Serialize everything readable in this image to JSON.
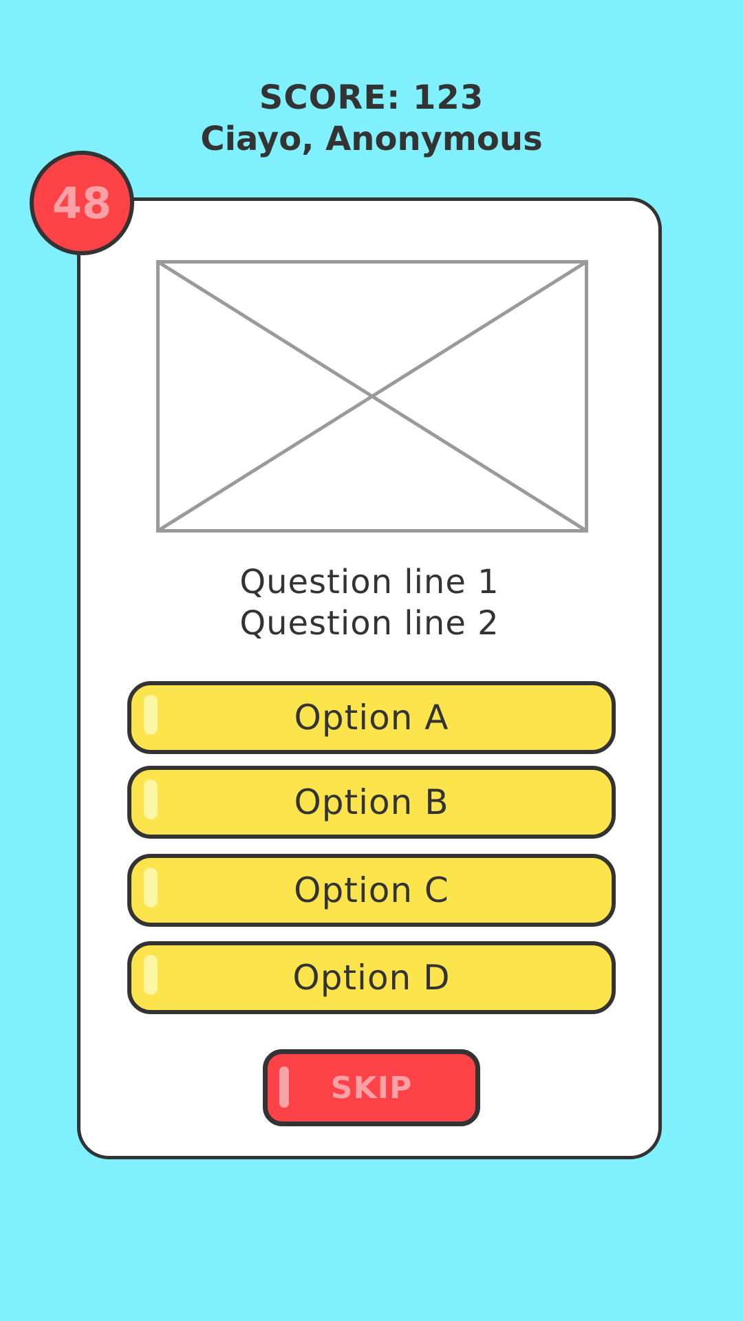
{
  "header": {
    "score_text": "SCORE: 123",
    "player_text": "Ciayo, Anonymous"
  },
  "timer": {
    "value": "48"
  },
  "question": {
    "line1": "Question line 1",
    "line2": "Question line 2",
    "image": "image-placeholder-icon"
  },
  "options": [
    {
      "label": "Option A"
    },
    {
      "label": "Option B"
    },
    {
      "label": "Option C"
    },
    {
      "label": "Option D"
    }
  ],
  "skip": {
    "label": "SKIP"
  },
  "colors": {
    "background": "#80f0fc",
    "card": "#ffffff",
    "outline": "#333333",
    "option_fill": "#fbe44c",
    "accent_red": "#fd4347",
    "accent_red_text": "#fca1a6",
    "placeholder_stroke": "#9a9a9a"
  }
}
